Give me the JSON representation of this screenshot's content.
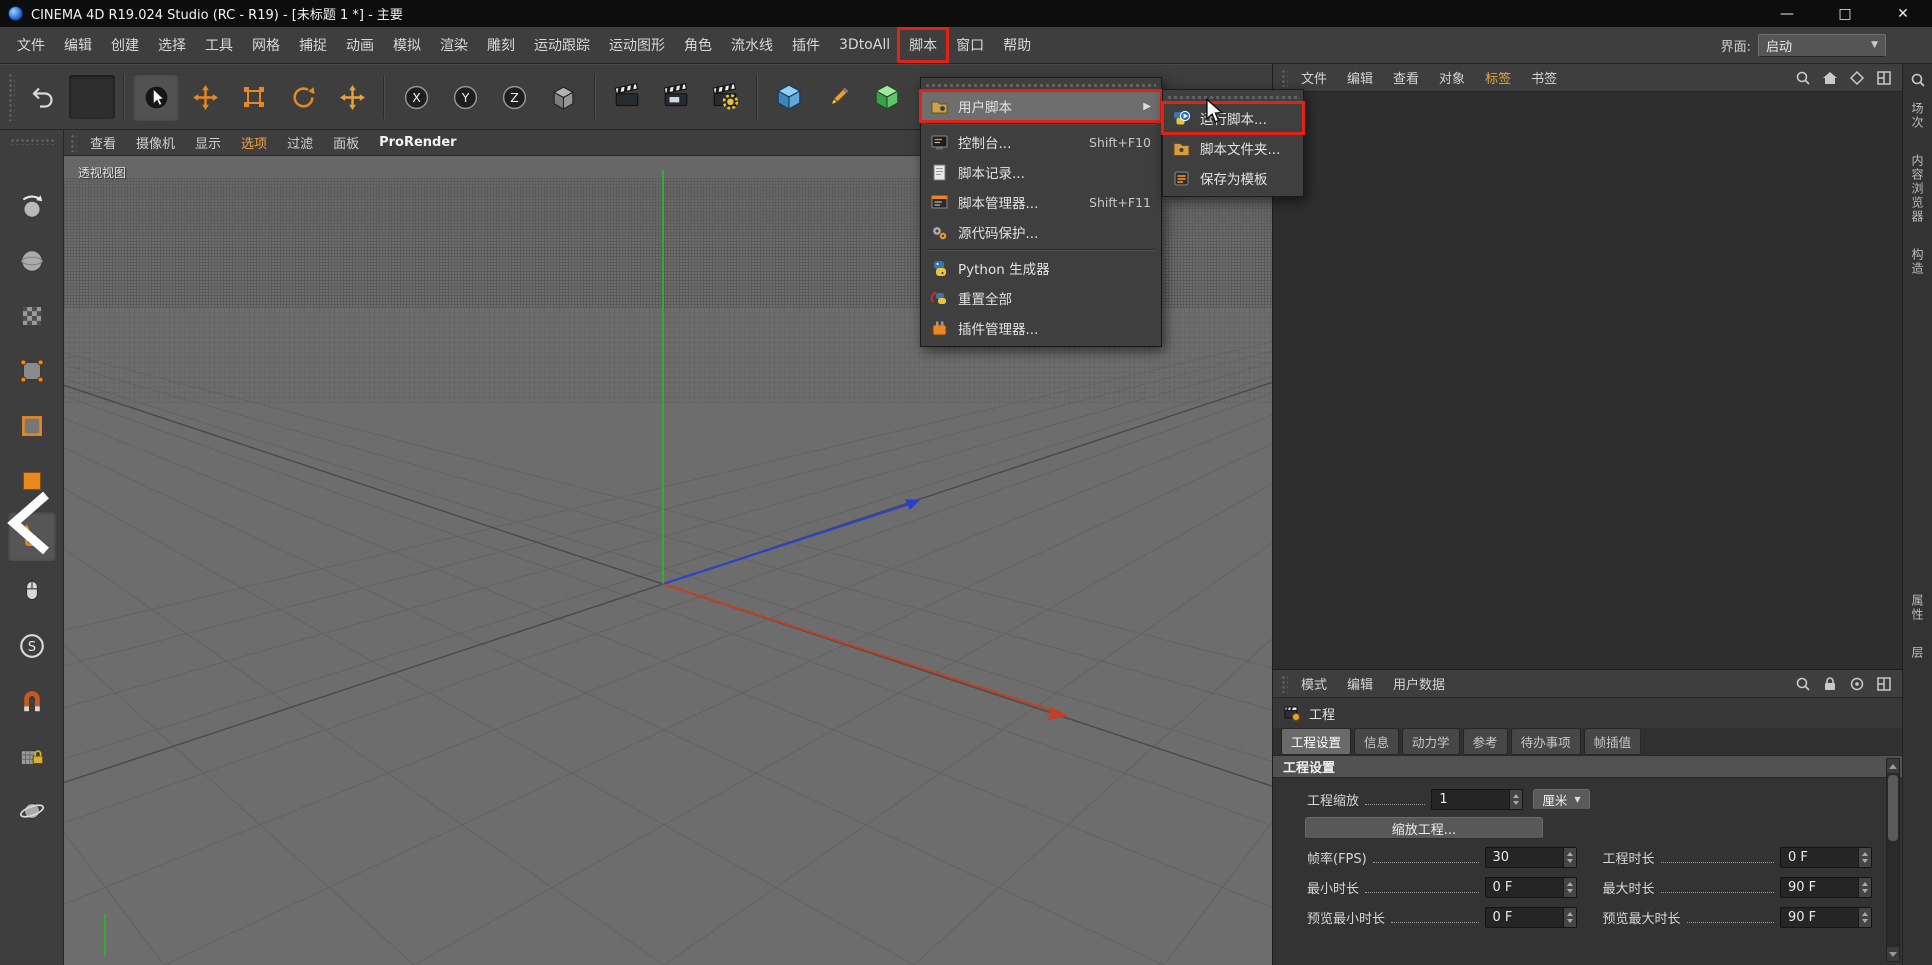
{
  "window": {
    "title": "CINEMA 4D R19.024 Studio (RC - R19) - [未标题 1 *] - 主要",
    "minimize": "—",
    "maximize": "□",
    "close": "✕"
  },
  "menubar": {
    "items": [
      "文件",
      "编辑",
      "创建",
      "选择",
      "工具",
      "网格",
      "捕捉",
      "动画",
      "模拟",
      "渲染",
      "雕刻",
      "运动跟踪",
      "运动图形",
      "角色",
      "流水线",
      "插件",
      "3DtoAll",
      "脚本",
      "窗口",
      "帮助"
    ],
    "interface_label": "界面:",
    "interface_value": "启动"
  },
  "toolbar": {
    "axis_locks": [
      "X",
      "Y",
      "Z"
    ]
  },
  "script_menu": {
    "items": [
      {
        "label": "用户脚本",
        "shortcut": ""
      },
      {
        "label": "控制台...",
        "shortcut": "Shift+F10"
      },
      {
        "label": "脚本记录...",
        "shortcut": ""
      },
      {
        "label": "脚本管理器...",
        "shortcut": "Shift+F11"
      },
      {
        "label": "源代码保护...",
        "shortcut": ""
      },
      {
        "label": "Python 生成器",
        "shortcut": ""
      },
      {
        "label": "重置全部",
        "shortcut": ""
      },
      {
        "label": "插件管理器...",
        "shortcut": ""
      }
    ]
  },
  "user_script_submenu": {
    "items": [
      "运行脚本...",
      "脚本文件夹...",
      "保存为模板"
    ]
  },
  "viewport": {
    "menu": [
      "查看",
      "摄像机",
      "显示",
      "选项",
      "过滤",
      "面板",
      "ProRender"
    ],
    "view_label": "透视视图"
  },
  "object_manager": {
    "menu": [
      "文件",
      "编辑",
      "查看",
      "对象",
      "标签",
      "书签"
    ]
  },
  "attributes": {
    "menu": [
      "模式",
      "编辑",
      "用户数据"
    ],
    "object_label": "工程",
    "tabs": [
      "工程设置",
      "信息",
      "动力学",
      "参考",
      "待办事项",
      "帧插值"
    ],
    "active_tab": "工程设置",
    "section": "工程设置",
    "scale_label": "工程缩放",
    "scale_value": "1",
    "scale_unit": "厘米",
    "scale_button": "缩放工程...",
    "fps_label": "帧率(FPS)",
    "fps_value": "30",
    "length_label": "工程时长",
    "length_value": "0 F",
    "min_label": "最小时长",
    "min_value": "0 F",
    "max_label": "最大时长",
    "max_value": "90 F",
    "preview_min_label": "预览最小时长",
    "preview_min_value": "0 F",
    "preview_max_label": "预览最大时长",
    "preview_max_value": "90 F"
  },
  "right_tabs": {
    "top": [
      "场次",
      "内容浏览器",
      "构造"
    ],
    "bottom": [
      "属性",
      "层"
    ]
  },
  "icons": {
    "dropdown_arrow": "▼",
    "submenu_arrow": "▶",
    "snap_s": "S"
  },
  "colors": {
    "annotation_red": "#e02318",
    "accent_orange": "#e8881f",
    "axis_green": "#2fae2f",
    "axis_blue": "#2b3fd0",
    "axis_red": "#c04028"
  }
}
